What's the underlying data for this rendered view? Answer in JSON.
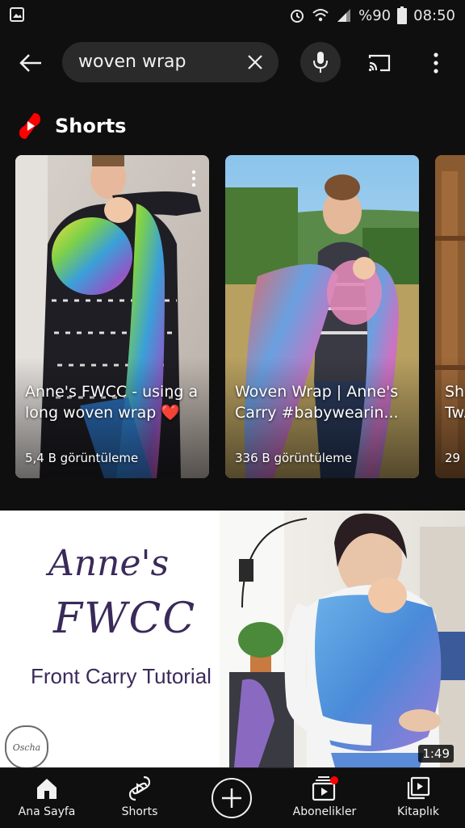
{
  "status_bar": {
    "battery": "%90",
    "time": "08:50"
  },
  "search": {
    "query": "woven wrap"
  },
  "shorts": {
    "section_title": "Shorts",
    "items": [
      {
        "title": "Anne's FWCC - using a long woven wrap ❤️",
        "views": "5,4 B görüntüleme"
      },
      {
        "title": "Woven Wrap | Anne's Carry #babywearin...",
        "views": "336 B görüntüleme"
      },
      {
        "title": "Sh... Tw...",
        "views": "29"
      }
    ]
  },
  "video": {
    "thumb_title_line1": "Anne's",
    "thumb_title_line2": "FWCC",
    "thumb_subtitle": "Front Carry Tutorial",
    "logo_text": "Oscha",
    "duration": "1:49"
  },
  "bottom_nav": {
    "items": [
      {
        "label": "Ana Sayfa"
      },
      {
        "label": "Shorts"
      },
      {
        "label": ""
      },
      {
        "label": "Abonelikler"
      },
      {
        "label": "Kitaplık"
      }
    ]
  },
  "colors": {
    "background": "#0f0f0f",
    "search_box": "#2a2a2a",
    "shorts_red": "#ff0000",
    "notification_dot": "#ff0000"
  }
}
